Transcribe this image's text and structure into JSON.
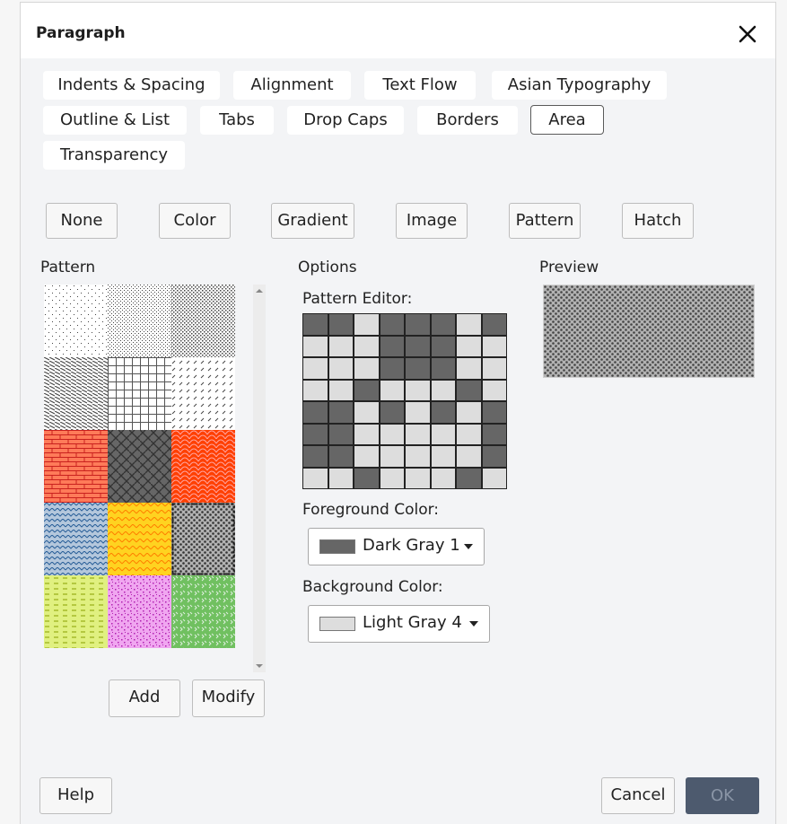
{
  "dialog": {
    "title": "Paragraph"
  },
  "tabs": [
    {
      "label": "Indents & Spacing"
    },
    {
      "label": "Alignment"
    },
    {
      "label": "Text Flow"
    },
    {
      "label": "Asian Typography"
    },
    {
      "label": "Outline & List"
    },
    {
      "label": "Tabs"
    },
    {
      "label": "Drop Caps"
    },
    {
      "label": "Borders"
    },
    {
      "label": "Area"
    },
    {
      "label": "Transparency"
    }
  ],
  "active_tab": "Area",
  "fill_types": [
    {
      "label": "None"
    },
    {
      "label": "Color"
    },
    {
      "label": "Gradient"
    },
    {
      "label": "Image"
    },
    {
      "label": "Pattern"
    },
    {
      "label": "Hatch"
    }
  ],
  "sections": {
    "pattern": "Pattern",
    "options": "Options",
    "preview": "Preview",
    "pattern_editor": "Pattern Editor:",
    "foreground": "Foreground Color:",
    "background": "Background Color:"
  },
  "foreground": {
    "name": "Dark Gray 1",
    "color": "#666666"
  },
  "background": {
    "name": "Light Gray 4",
    "color": "#dddddd"
  },
  "pattern_buttons": {
    "add": "Add",
    "modify": "Modify"
  },
  "footer": {
    "help": "Help",
    "cancel": "Cancel",
    "ok": "OK"
  },
  "patterns": [
    {
      "name": "5 Percent",
      "fg": "#444444",
      "bg": "#ffffff"
    },
    {
      "name": "10 Percent",
      "fg": "#444444",
      "bg": "#ffffff"
    },
    {
      "name": "20 Percent",
      "fg": "#444444",
      "bg": "#ffffff"
    },
    {
      "name": "Light Downward Diagonal",
      "fg": "#444444",
      "bg": "#ffffff"
    },
    {
      "name": "Small Grid",
      "fg": "#444444",
      "bg": "#ffffff"
    },
    {
      "name": "Dashed Diagonal",
      "fg": "#444444",
      "bg": "#ffffff"
    },
    {
      "name": "Bricks",
      "fg": "#ff7b59",
      "bg": "#c9211e"
    },
    {
      "name": "Weave",
      "fg": "#666666",
      "bg": "#333333"
    },
    {
      "name": "Shingle",
      "fg": "#ff4000",
      "bg": "#ffa6a6"
    },
    {
      "name": "Wave",
      "fg": "#b4c7dc",
      "bg": "#2a6099"
    },
    {
      "name": "Zig Zag",
      "fg": "#ffd320",
      "bg": "#ff8000"
    },
    {
      "name": "Sphere",
      "fg": "#b2b2b2",
      "bg": "#333333"
    },
    {
      "name": "Dashed Horizontal",
      "fg": "#e0f080",
      "bg": "#88a000"
    },
    {
      "name": "Confetti",
      "fg": "#f0a6f0",
      "bg": "#b020b0"
    },
    {
      "name": "Divot",
      "fg": "#70c060",
      "bg": "#e0f0e0"
    }
  ],
  "selected_pattern_index": 11,
  "editor_grid": [
    [
      1,
      1,
      0,
      1,
      1,
      1,
      0,
      1
    ],
    [
      0,
      0,
      0,
      1,
      1,
      1,
      0,
      0
    ],
    [
      0,
      0,
      0,
      1,
      1,
      1,
      0,
      0
    ],
    [
      0,
      0,
      1,
      0,
      0,
      0,
      1,
      0
    ],
    [
      1,
      1,
      0,
      1,
      0,
      1,
      0,
      1
    ],
    [
      1,
      1,
      0,
      0,
      0,
      0,
      0,
      1
    ],
    [
      1,
      1,
      0,
      0,
      0,
      0,
      0,
      1
    ],
    [
      0,
      0,
      1,
      0,
      0,
      0,
      1,
      0
    ]
  ]
}
